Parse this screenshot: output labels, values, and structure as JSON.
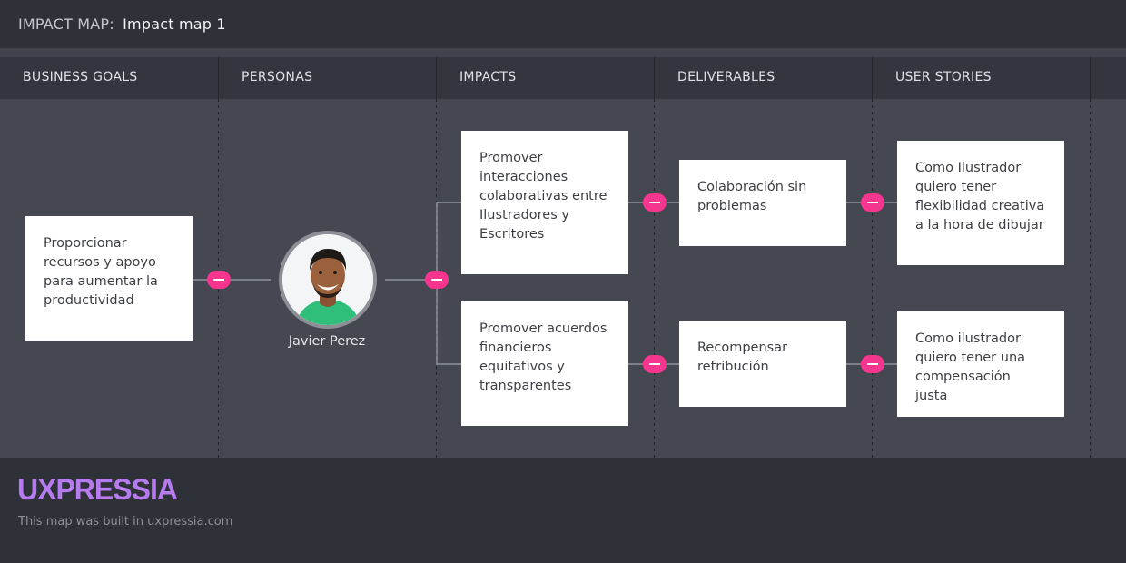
{
  "header": {
    "label": "IMPACT MAP:",
    "title": "Impact map 1"
  },
  "columns": [
    "BUSINESS GOALS",
    "PERSONAS",
    "IMPACTS",
    "DELIVERABLES",
    "USER STORIES"
  ],
  "goal": {
    "text": "Proporcionar recursos y apoyo para aumentar la productividad"
  },
  "persona": {
    "name": "Javier Perez"
  },
  "impacts": [
    {
      "text": "Promover interacciones colaborativas entre Ilustradores y Escritores"
    },
    {
      "text": "Promover acuerdos financieros equitativos y transparentes"
    }
  ],
  "deliverables": [
    {
      "text": "Colaboración sin problemas"
    },
    {
      "text": "Recompensar retribución"
    }
  ],
  "user_stories": [
    {
      "text": "Como Ilustrador quiero tener flexibilidad creativa a la hora de dibujar"
    },
    {
      "text": "Como ilustrador quiero tener una compensación justa"
    }
  ],
  "footer": {
    "logo": "UXPRESSIA",
    "built": "This map was built in uxpressia.com"
  },
  "colors": {
    "accent": "#f6358f",
    "logo": "#b77bf0",
    "card": "#ffffff"
  }
}
